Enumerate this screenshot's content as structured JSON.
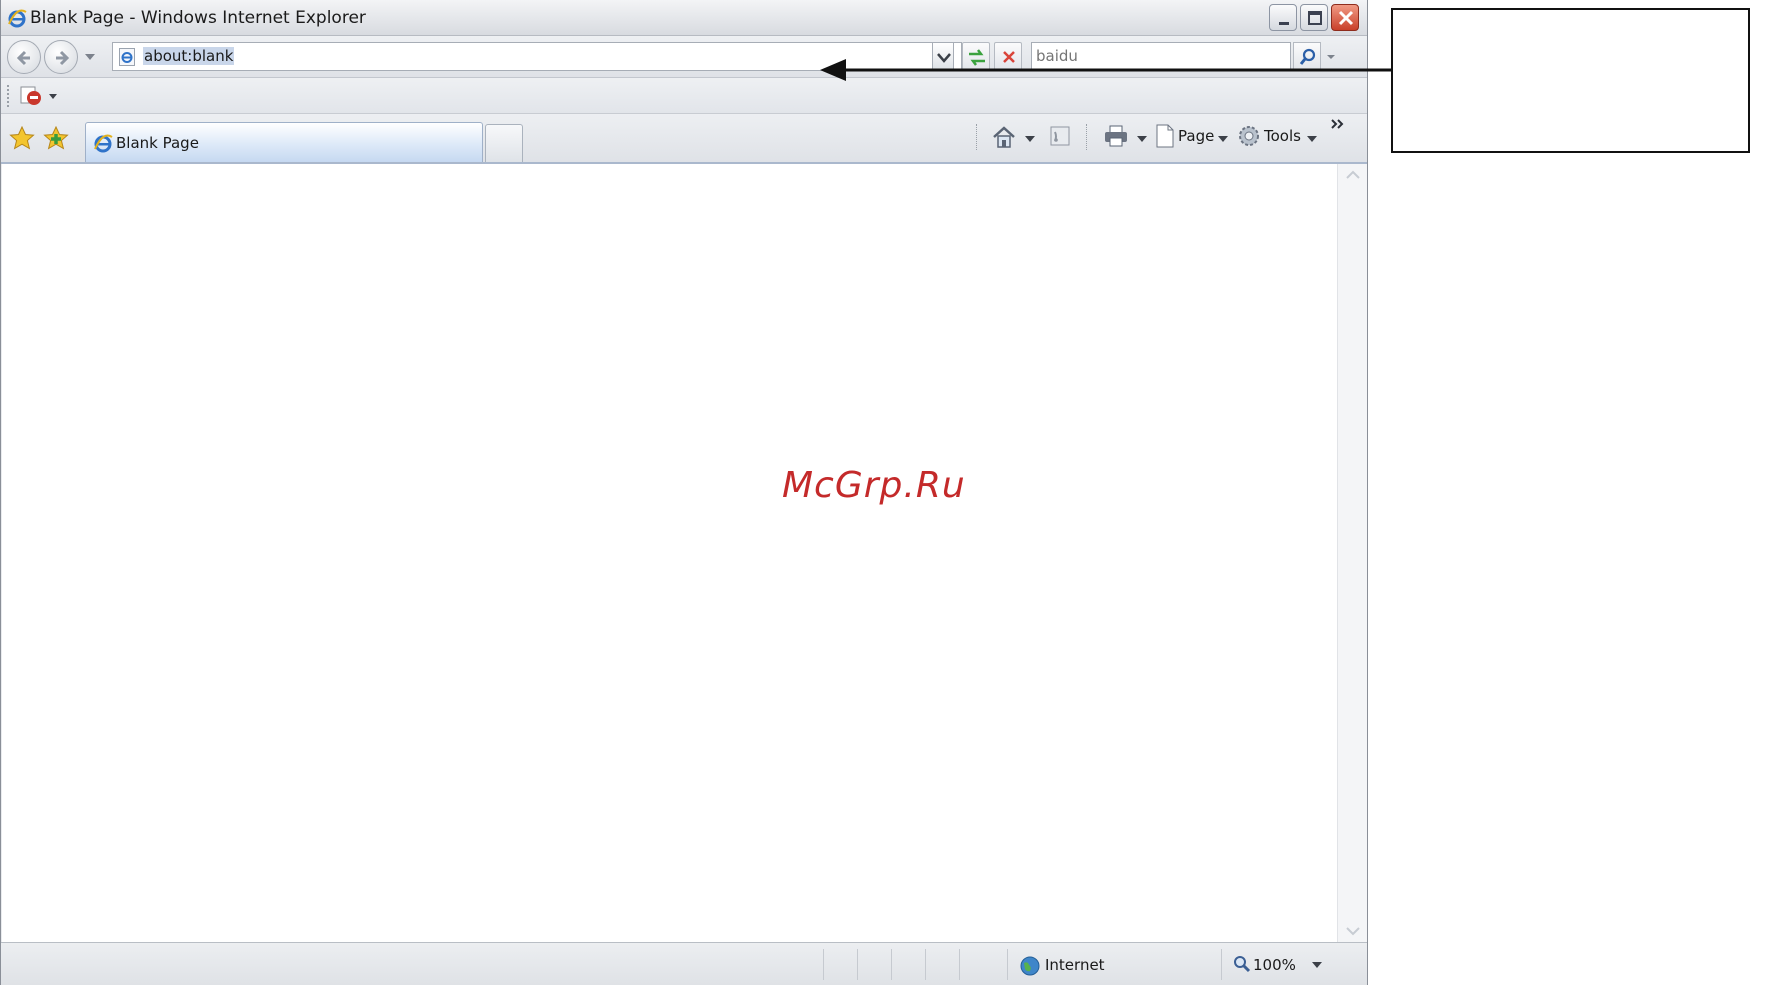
{
  "window": {
    "title": "Blank Page - Windows Internet Explorer",
    "controls": [
      "minimize",
      "maximize",
      "close"
    ]
  },
  "navigation": {
    "address": "about:blank",
    "search_placeholder": "baidu"
  },
  "tabs": [
    {
      "label": "Blank Page",
      "active": true
    }
  ],
  "command_bar": {
    "page_label": "Page",
    "tools_label": "Tools"
  },
  "content": {
    "watermark": "McGrp.Ru"
  },
  "status_bar": {
    "zone": "Internet",
    "zoom": "100%"
  },
  "icons": [
    "ie-logo-icon",
    "back-icon",
    "forward-icon",
    "refresh-icon",
    "stop-icon",
    "search-icon",
    "favorites-star-icon",
    "add-favorites-icon",
    "home-icon",
    "feeds-icon",
    "print-icon",
    "page-icon",
    "tools-gear-icon",
    "globe-icon",
    "zoom-icon"
  ],
  "colors": {
    "watermark": "#c42a2a",
    "close_button": "#d0452f",
    "tab_active": "#c6d9f1"
  }
}
